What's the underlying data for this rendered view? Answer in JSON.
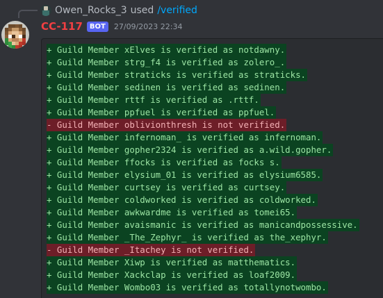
{
  "command": {
    "user": "Owen_Rocks_3",
    "used_word": "used",
    "name": "/verified"
  },
  "message": {
    "author": "CC-117",
    "badge": "BOT",
    "timestamp": "27/09/2023 22:34",
    "author_color": "#f23f42"
  },
  "lines": [
    {
      "type": "add",
      "text": "+ Guild Member xElves is verified as notdawny."
    },
    {
      "type": "add",
      "text": "+ Guild Member strg_f4 is verified as zolero_."
    },
    {
      "type": "add",
      "text": "+ Guild Member straticks is verified as straticks."
    },
    {
      "type": "add",
      "text": "+ Guild Member sedinen is verified as sedinen."
    },
    {
      "type": "add",
      "text": "+ Guild Member rttf is verified as .rttf."
    },
    {
      "type": "add",
      "text": "+ Guild Member ppfuel is verified as ppfuel."
    },
    {
      "type": "del",
      "text": "- Guild Member oblivionthresh is not verified."
    },
    {
      "type": "add",
      "text": "+ Guild Member infernoman_ is verified as infernoman."
    },
    {
      "type": "add",
      "text": "+ Guild Member gopher2324 is verified as a.wild.gopher."
    },
    {
      "type": "add",
      "text": "+ Guild Member ffocks is verified as focks s."
    },
    {
      "type": "add",
      "text": "+ Guild Member elysium_01 is verified as elysium6585."
    },
    {
      "type": "add",
      "text": "+ Guild Member curtsey is verified as curtsey."
    },
    {
      "type": "add",
      "text": "+ Guild Member coldworked is verified as coldworked."
    },
    {
      "type": "add",
      "text": "+ Guild Member awkwardme is verified as tomei65."
    },
    {
      "type": "add",
      "text": "+ Guild Member avaismanic is verified as manicandpossessive."
    },
    {
      "type": "add",
      "text": "+ Guild Member _The_Zephyr_ is verified as the_xephyr."
    },
    {
      "type": "del",
      "text": "- Guild Member _Itachey is not verified."
    },
    {
      "type": "add",
      "text": "+ Guild Member Xiwp is verified as matthematics."
    },
    {
      "type": "add",
      "text": "+ Guild Member Xackclap is verified as loaf2009."
    },
    {
      "type": "add",
      "text": "+ Guild Member Wombo03 is verified as totallynotwombo."
    }
  ]
}
